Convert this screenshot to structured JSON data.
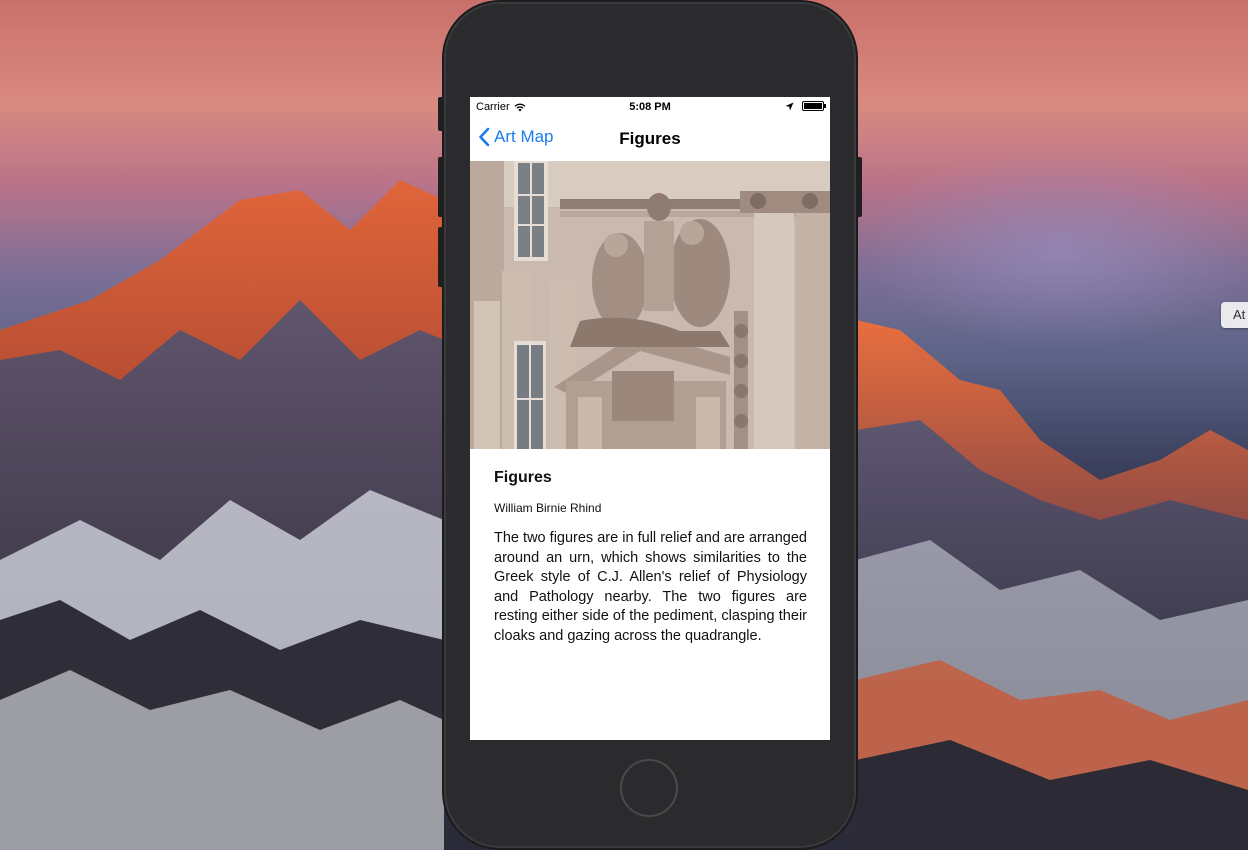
{
  "side_pill": {
    "label": "At"
  },
  "status_bar": {
    "carrier": "Carrier",
    "time": "5:08 PM",
    "wifi_icon": "wifi-icon",
    "location_icon": "location-arrow-icon",
    "battery_level": 1.0
  },
  "nav": {
    "back_label": "Art Map",
    "title": "Figures"
  },
  "artwork": {
    "title": "Figures",
    "artist": "William Birnie Rhind",
    "description": "The two figures are in full relief and are arranged around an urn, which shows similarities to the Greek style of C.J. Allen's relief of Physiology and Pathology nearby.  The two figures are resting either side of the pediment, clasping their cloaks and gazing across the quadrangle."
  },
  "colors": {
    "accent": "#1a7cf0"
  }
}
